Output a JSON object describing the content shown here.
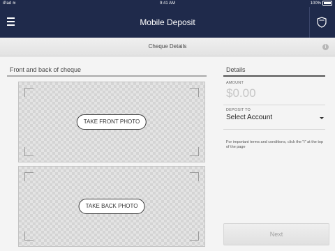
{
  "status_bar": {
    "device": "iPad",
    "time": "9:41 AM",
    "battery": "100%"
  },
  "nav": {
    "title": "Mobile Deposit",
    "menu_icon": "hamburger-menu-icon",
    "right_icon": "shield-icon"
  },
  "subheader": {
    "title": "Cheque Details",
    "info_icon": "info-icon"
  },
  "photos": {
    "section_title": "Front and back of cheque",
    "front_button": "TAKE FRONT PHOTO",
    "back_button": "TAKE BACK PHOTO"
  },
  "details": {
    "section_title": "Details",
    "amount_label": "AMOUNT",
    "amount_value": "$0.00",
    "deposit_label": "DEPOSIT TO",
    "deposit_value": "Select Account",
    "terms_text": "For important terms and conditions, click the \"i\" at the top of the page"
  },
  "footer": {
    "next_label": "Next"
  },
  "colors": {
    "nav_background": "#1f2a4b",
    "section_rule": "#aaaaaa"
  }
}
